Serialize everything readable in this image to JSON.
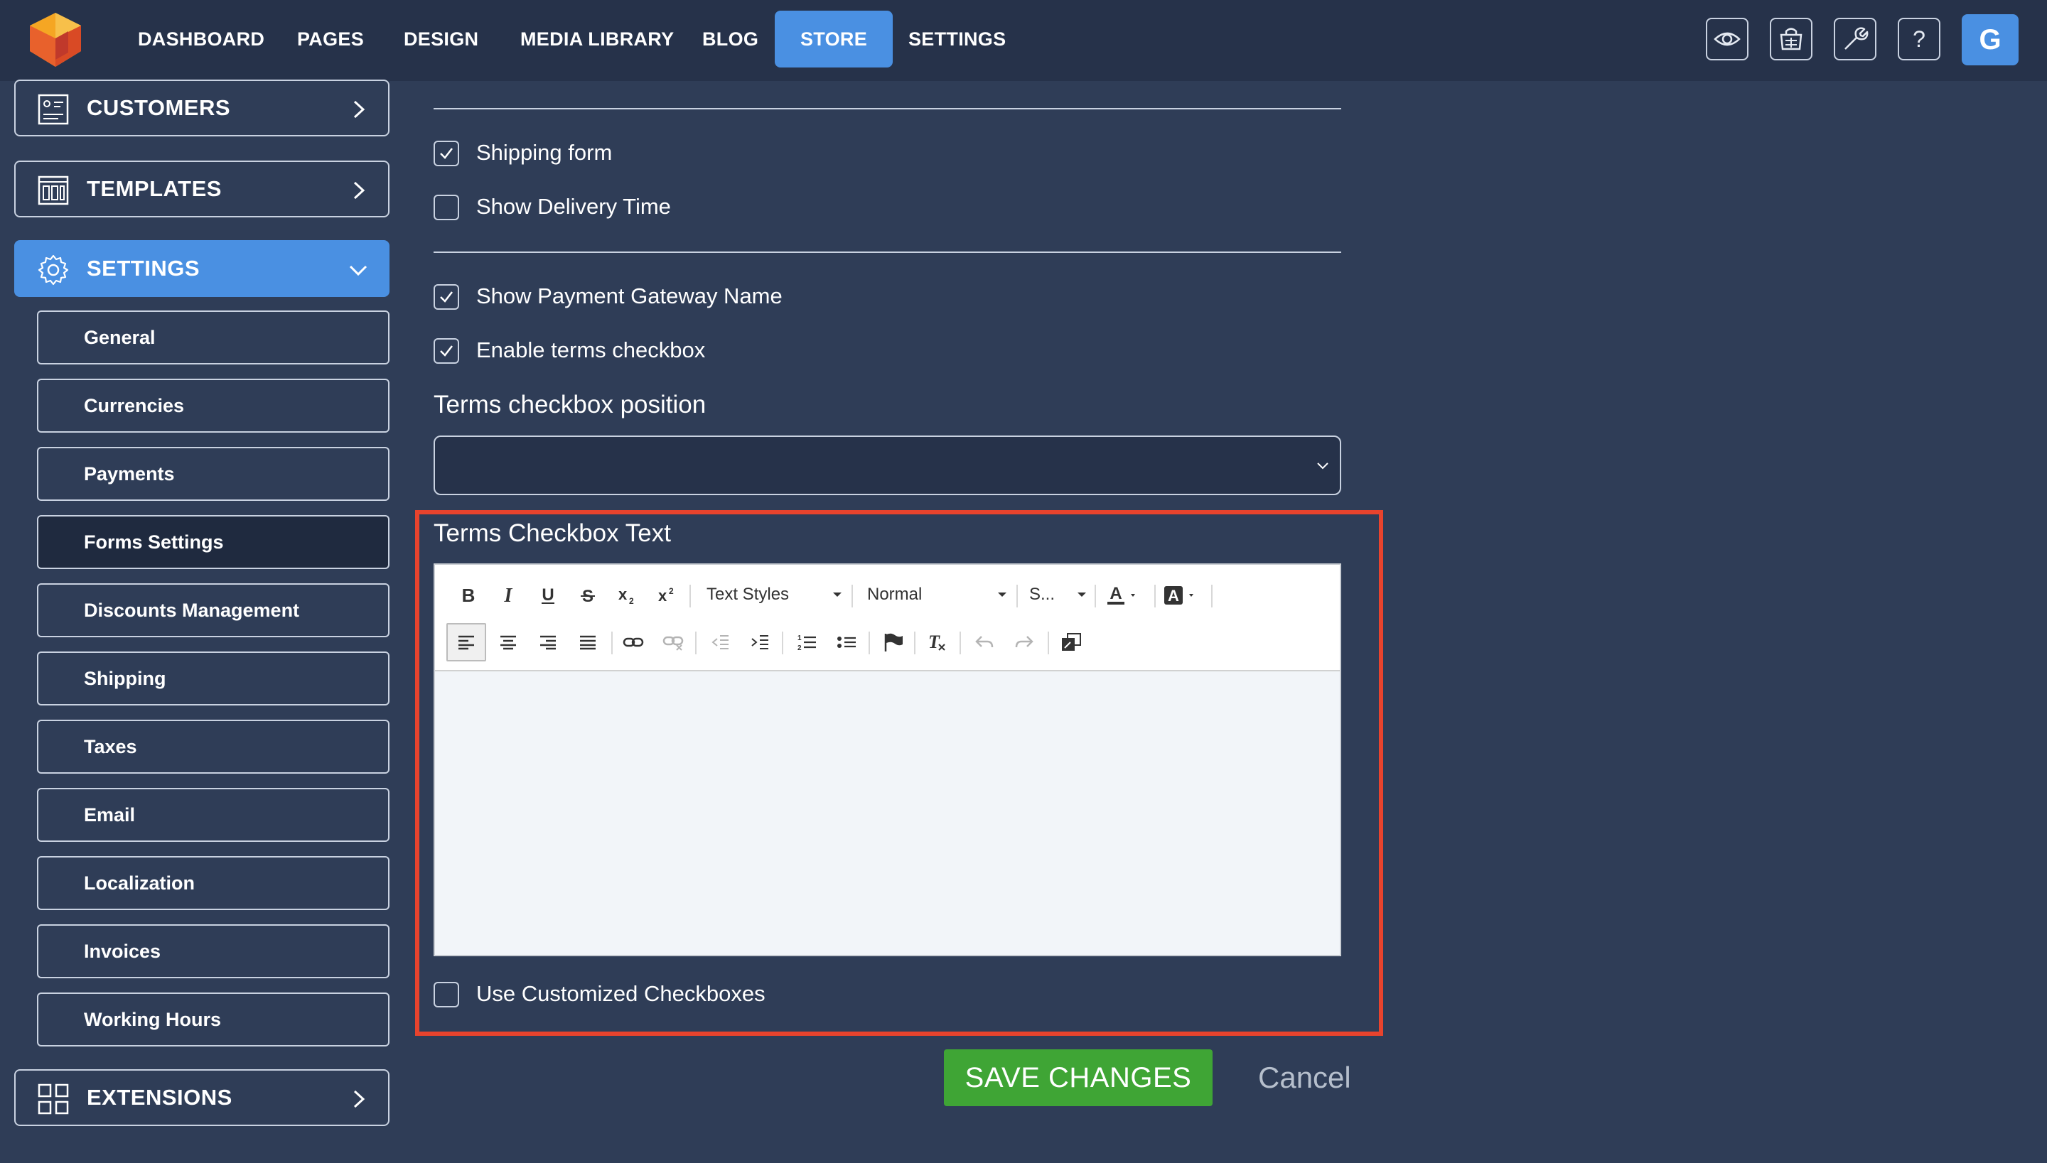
{
  "topnav": {
    "items": [
      "DASHBOARD",
      "PAGES",
      "DESIGN",
      "MEDIA LIBRARY",
      "BLOG",
      "STORE",
      "SETTINGS"
    ],
    "active": "STORE",
    "tools": [
      "eye-icon",
      "store-icon",
      "wrench-icon",
      "help-icon"
    ],
    "avatar_letter": "G"
  },
  "sidebar": {
    "customers": "CUSTOMERS",
    "templates": "TEMPLATES",
    "settings": "SETTINGS",
    "sub_items": [
      "General",
      "Currencies",
      "Payments",
      "Forms Settings",
      "Discounts Management",
      "Shipping",
      "Taxes",
      "Email",
      "Localization",
      "Invoices",
      "Working Hours"
    ],
    "active_sub": "Forms Settings",
    "extensions": "EXTENSIONS"
  },
  "form": {
    "checkboxes": [
      {
        "label": "Shipping form",
        "checked": true
      },
      {
        "label": "Show Delivery Time",
        "checked": false
      },
      {
        "label": "Show Payment Gateway Name",
        "checked": true
      },
      {
        "label": "Enable terms checkbox",
        "checked": true
      }
    ],
    "terms_position_label": "Terms checkbox position",
    "terms_position_value": "",
    "terms_text_label": "Terms Checkbox Text",
    "editor": {
      "text_styles": "Text Styles",
      "format": "Normal",
      "size": "S...",
      "content": ""
    },
    "custom_checkboxes_label": "Use Customized Checkboxes",
    "custom_checkboxes_checked": false
  },
  "actions": {
    "save": "SAVE CHANGES",
    "cancel": "Cancel"
  },
  "colors": {
    "background": "#2f3d57",
    "topbar": "#26324a",
    "accent": "#4a90e2",
    "save": "#3fa535",
    "highlight": "#e8432d"
  }
}
